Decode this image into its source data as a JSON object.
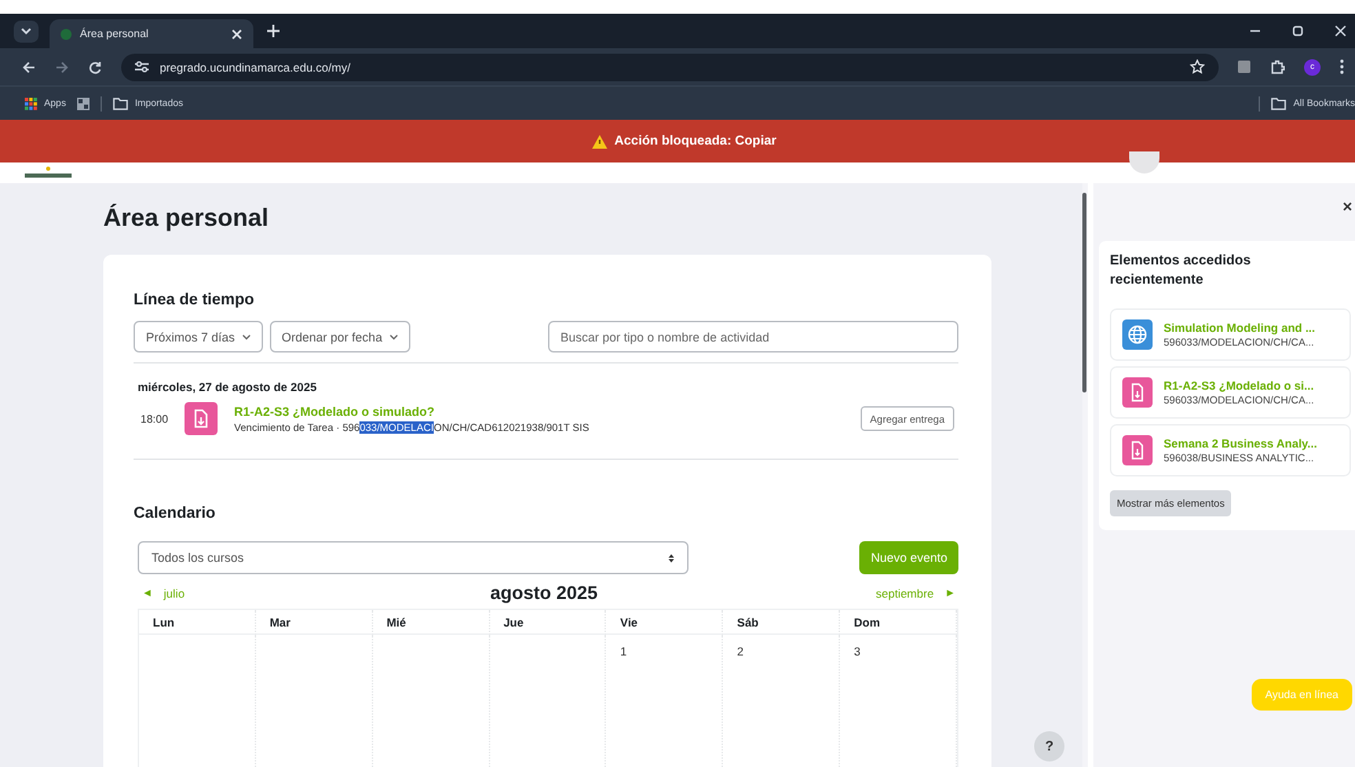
{
  "browser": {
    "tab_title": "Área personal",
    "url": "pregrado.ucundinamarca.edu.co/my/",
    "bookmarks": [
      {
        "label": "Apps",
        "kind": "apps"
      },
      {
        "label": "Importados",
        "kind": "folder"
      }
    ],
    "all_bookmarks": "All Bookmarks",
    "profile_initial": "c"
  },
  "alert": {
    "text": "Acción bloqueada: Copiar"
  },
  "page_title": "Área personal",
  "timeline": {
    "title": "Línea de tiempo",
    "filters": [
      "Próximos 7 días",
      "Ordenar por fecha"
    ],
    "search_placeholder": "Buscar por tipo o nombre de actividad",
    "groups": [
      {
        "date": "miércoles, 27 de agosto de 2025",
        "items": [
          {
            "time": "18:00",
            "title": "R1-A2-S3 ¿Modelado o simulado?",
            "subtitle_before": "Vencimiento de Tarea · 596",
            "subtitle_selected": "033/MODELACI",
            "subtitle_after": "ON/CH/CAD612021938/901T SIS",
            "action": "Agregar entrega"
          }
        ]
      }
    ]
  },
  "calendar": {
    "title": "Calendario",
    "course_select": "Todos los cursos",
    "new_event": "Nuevo evento",
    "prev_month": "julio",
    "prev_arrow": "◄",
    "month": "agosto 2025",
    "next_month": "septiembre",
    "next_arrow": "►",
    "weekdays": [
      "Lun",
      "Mar",
      "Mié",
      "Jue",
      "Vie",
      "Sáb",
      "Dom"
    ],
    "first_week": [
      {
        "kind": "blank"
      },
      {
        "kind": "blank"
      },
      {
        "kind": "blank"
      },
      {
        "kind": "blank"
      },
      {
        "kind": "day",
        "label": "1"
      },
      {
        "kind": "day",
        "label": "2"
      },
      {
        "kind": "day",
        "label": "3"
      }
    ]
  },
  "help_button": "?",
  "drawer": {
    "close": "×",
    "title": "Elementos accedidos recientemente",
    "items": [
      {
        "kind": "url",
        "title": "Simulation Modeling and ...",
        "course": "596033/MODELACION/CH/CA..."
      },
      {
        "kind": "assign",
        "title": "R1-A2-S3 ¿Modelado o si...",
        "course": "596033/MODELACION/CH/CA..."
      },
      {
        "kind": "assign",
        "title": "Semana 2 Business Analy...",
        "course": "596038/BUSINESS ANALYTIC..."
      }
    ],
    "more": "Mostrar más elementos"
  },
  "online_help": "Ayuda en línea"
}
